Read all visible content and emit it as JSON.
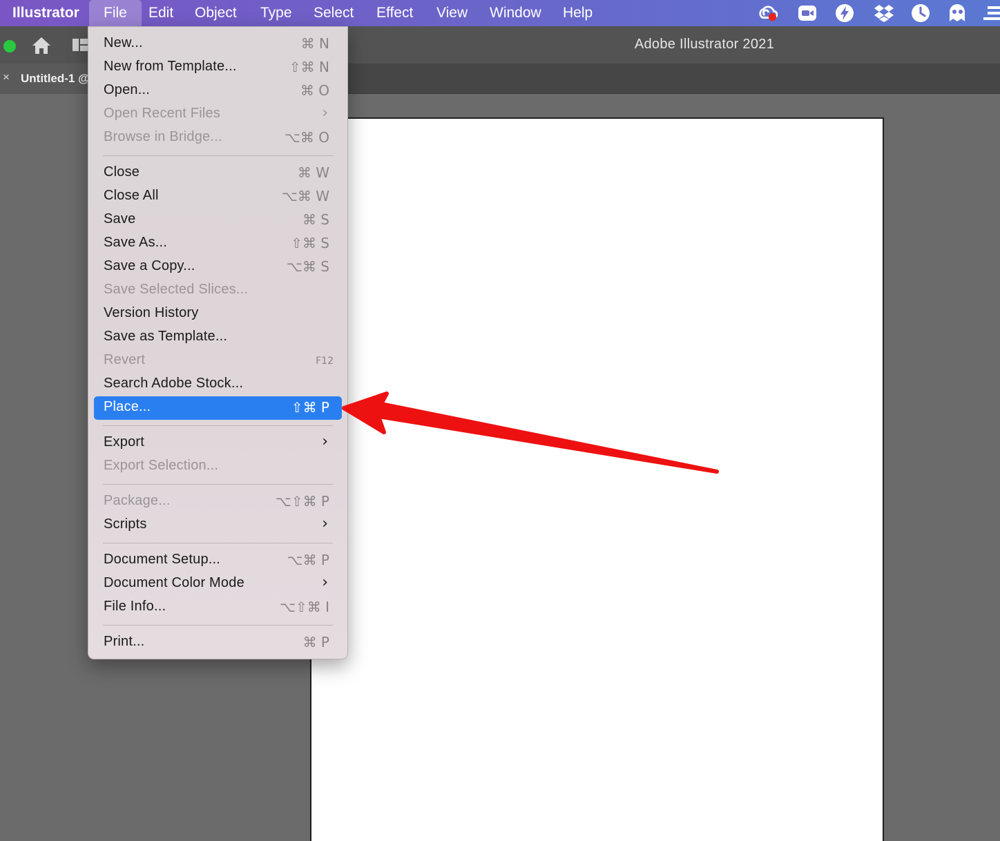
{
  "menubar": {
    "app": "Illustrator",
    "items": [
      "File",
      "Edit",
      "Object",
      "Type",
      "Select",
      "Effect",
      "View",
      "Window",
      "Help"
    ],
    "active": "File",
    "tray_icons": [
      "creative-cloud-icon",
      "zoom-icon",
      "bolt-icon",
      "dropbox-icon",
      "clock-icon",
      "ghost-icon",
      "notes-icon"
    ]
  },
  "window": {
    "title": "Adobe Illustrator 2021"
  },
  "tab": {
    "close": "×",
    "title": "Untitled-1 @"
  },
  "file_menu": {
    "items": [
      {
        "label": "New...",
        "shortcut": "⌘ N"
      },
      {
        "label": "New from Template...",
        "shortcut": "⇧⌘ N"
      },
      {
        "label": "Open...",
        "shortcut": "⌘ O"
      },
      {
        "label": "Open Recent Files",
        "submenu": "›"
      },
      {
        "label": "Browse in Bridge...",
        "shortcut": "⌥⌘ O"
      },
      {
        "label": "Close",
        "shortcut": "⌘ W"
      },
      {
        "label": "Close All",
        "shortcut": "⌥⌘ W"
      },
      {
        "label": "Save",
        "shortcut": "⌘ S"
      },
      {
        "label": "Save As...",
        "shortcut": "⇧⌘ S"
      },
      {
        "label": "Save a Copy...",
        "shortcut": "⌥⌘ S"
      },
      {
        "label": "Save Selected Slices..."
      },
      {
        "label": "Version History"
      },
      {
        "label": "Save as Template..."
      },
      {
        "label": "Revert",
        "shortcut": "F12"
      },
      {
        "label": "Search Adobe Stock..."
      },
      {
        "label": "Place...",
        "shortcut": "⇧⌘ P"
      },
      {
        "label": "Export",
        "submenu": "›"
      },
      {
        "label": "Export Selection..."
      },
      {
        "label": "Package...",
        "shortcut": "⌥⇧⌘ P"
      },
      {
        "label": "Scripts",
        "submenu": "›"
      },
      {
        "label": "Document Setup...",
        "shortcut": "⌥⌘ P"
      },
      {
        "label": "Document Color Mode",
        "submenu": "›"
      },
      {
        "label": "File Info...",
        "shortcut": "⌥⇧⌘ I"
      },
      {
        "label": "Print...",
        "shortcut": "⌘ P"
      }
    ],
    "highlighted": "Place...",
    "disabled": [
      "Open Recent Files",
      "Browse in Bridge...",
      "Save Selected Slices...",
      "Revert",
      "Export Selection...",
      "Package..."
    ]
  },
  "colors": {
    "highlight": "#2a7ff0",
    "annotation_arrow": "#ee1111",
    "mac_green": "#2ac840"
  }
}
